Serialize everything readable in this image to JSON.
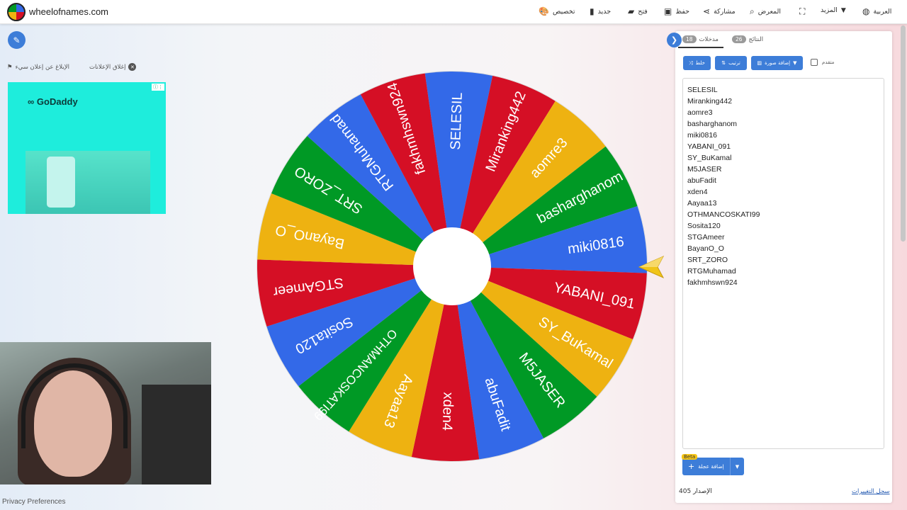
{
  "header": {
    "site_name": "wheelofnames.com",
    "nav": {
      "customize": "تخصيص",
      "new": "جديد",
      "open": "فتح",
      "save": "حفظ",
      "share": "مشاركة",
      "gallery": "المعرض",
      "more": "المزيد",
      "language": "العربية"
    }
  },
  "ads": {
    "close_ads": "إغلاق الإعلانات",
    "report_ad": "الإبلاغ عن إعلان سيء",
    "advertiser": "GoDaddy"
  },
  "footer": {
    "privacy": "Privacy Preferences"
  },
  "wheel": {
    "colors": [
      "#3369e8",
      "#d50f25",
      "#eeb211",
      "#009925"
    ],
    "segments": [
      "SELESIL",
      "Miranking442",
      "aomre3",
      "basharghanom",
      "miki0816",
      "YABANI_091",
      "SY_BuKamal",
      "M5JASER",
      "abuFadit",
      "xden4",
      "Aayaa13",
      "OTHMANCOSKATI99",
      "Sosita120",
      "STGAmeer",
      "BayanO_O",
      "SRT_ZORO",
      "RTGMuhamad",
      "fakhmhswn924"
    ]
  },
  "panel": {
    "tab_entries": "مدخلات",
    "entries_count": "18",
    "tab_results": "النتائج",
    "results_count": "26",
    "shuffle_label": "خلط",
    "sort_label": "ترتيب",
    "add_image_label": "إضافة صورة",
    "advanced_label": "متقدم",
    "entries": [
      "SELESIL",
      "Miranking442",
      "aomre3",
      "basharghanom",
      "miki0816",
      "YABANI_091",
      "SY_BuKamal",
      "M5JASER",
      "abuFadit",
      "xden4",
      "Aayaa13",
      "OTHMANCOSKATI99",
      "Sosita120",
      "STGAmeer",
      "BayanO_O",
      "SRT_ZORO",
      "RTGMuhamad",
      "fakhmhswn924"
    ],
    "beta": "Beta",
    "add_wheel": "إضافة عجلة",
    "version_label": "الإصدار",
    "version_number": "405",
    "changelog": "سجل التغييرات"
  }
}
